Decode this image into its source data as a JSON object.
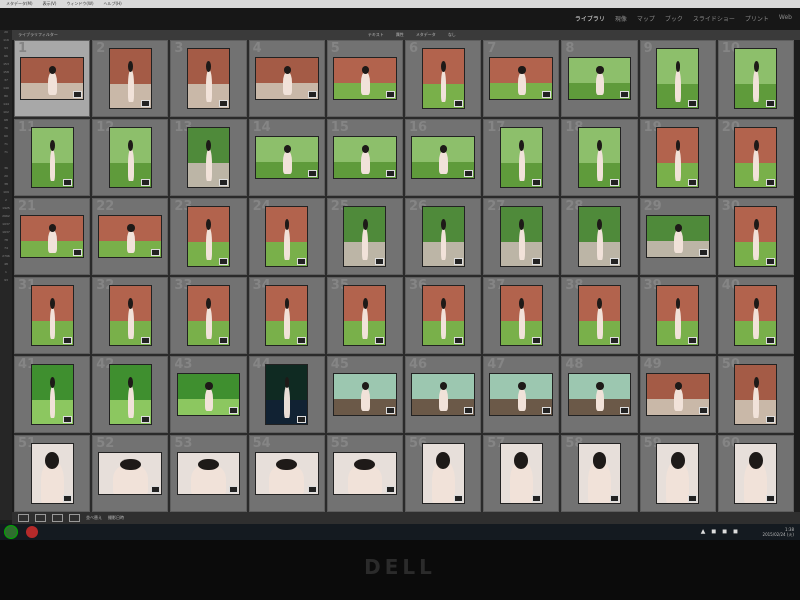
{
  "menubar": {
    "items": [
      "メタデータ(M)",
      "表示(V)",
      "ウィンドウ(W)",
      "ヘルプ(H)"
    ]
  },
  "modules": {
    "items": [
      "ライブラリ",
      "現像",
      "マップ",
      "ブック",
      "スライドショー",
      "プリント",
      "Web"
    ],
    "active_index": 0
  },
  "grid_header": {
    "left_label": "ライブラリフィルター",
    "tabs": [
      "テキスト",
      "属性",
      "メタデータ",
      "なし"
    ]
  },
  "left_numbers": [
    "20",
    "116",
    "93",
    "66",
    "153",
    "158",
    "37",
    "140",
    "80",
    "144",
    "102",
    "68",
    "76",
    "60",
    "71",
    "71",
    "",
    "36",
    "20",
    "38",
    "109",
    "2",
    "1925",
    "2662",
    "1037",
    "1637",
    "78",
    "74",
    "2796",
    "48",
    "1",
    "93"
  ],
  "thumbnails": [
    {
      "idx": "1",
      "o": "land",
      "s": "s-brick"
    },
    {
      "idx": "2",
      "o": "port",
      "s": "s-brick"
    },
    {
      "idx": "3",
      "o": "port",
      "s": "s-brick"
    },
    {
      "idx": "4",
      "o": "land",
      "s": "s-brick"
    },
    {
      "idx": "5",
      "o": "land",
      "s": "s-building"
    },
    {
      "idx": "6",
      "o": "port",
      "s": "s-building"
    },
    {
      "idx": "7",
      "o": "land",
      "s": "s-building"
    },
    {
      "idx": "8",
      "o": "land",
      "s": "s-lawn"
    },
    {
      "idx": "9",
      "o": "port",
      "s": "s-lawn"
    },
    {
      "idx": "10",
      "o": "port",
      "s": "s-lawn"
    },
    {
      "idx": "11",
      "o": "port",
      "s": "s-lawn"
    },
    {
      "idx": "12",
      "o": "port",
      "s": "s-lawn"
    },
    {
      "idx": "13",
      "o": "port",
      "s": "s-park"
    },
    {
      "idx": "14",
      "o": "land",
      "s": "s-lawn"
    },
    {
      "idx": "15",
      "o": "land",
      "s": "s-lawn"
    },
    {
      "idx": "16",
      "o": "land",
      "s": "s-lawn"
    },
    {
      "idx": "17",
      "o": "port",
      "s": "s-lawn"
    },
    {
      "idx": "18",
      "o": "port",
      "s": "s-lawn"
    },
    {
      "idx": "19",
      "o": "port",
      "s": "s-building"
    },
    {
      "idx": "20",
      "o": "port",
      "s": "s-building"
    },
    {
      "idx": "21",
      "o": "land",
      "s": "s-building"
    },
    {
      "idx": "22",
      "o": "land",
      "s": "s-building"
    },
    {
      "idx": "23",
      "o": "port",
      "s": "s-building"
    },
    {
      "idx": "24",
      "o": "port",
      "s": "s-building"
    },
    {
      "idx": "25",
      "o": "port",
      "s": "s-park"
    },
    {
      "idx": "26",
      "o": "port",
      "s": "s-park"
    },
    {
      "idx": "27",
      "o": "port",
      "s": "s-park"
    },
    {
      "idx": "28",
      "o": "port",
      "s": "s-park"
    },
    {
      "idx": "29",
      "o": "land",
      "s": "s-park"
    },
    {
      "idx": "30",
      "o": "port",
      "s": "s-building"
    },
    {
      "idx": "31",
      "o": "port",
      "s": "s-building"
    },
    {
      "idx": "32",
      "o": "port",
      "s": "s-building"
    },
    {
      "idx": "33",
      "o": "port",
      "s": "s-building"
    },
    {
      "idx": "34",
      "o": "port",
      "s": "s-building"
    },
    {
      "idx": "35",
      "o": "port",
      "s": "s-building"
    },
    {
      "idx": "36",
      "o": "port",
      "s": "s-building"
    },
    {
      "idx": "37",
      "o": "port",
      "s": "s-building"
    },
    {
      "idx": "38",
      "o": "port",
      "s": "s-building"
    },
    {
      "idx": "39",
      "o": "port",
      "s": "s-building"
    },
    {
      "idx": "40",
      "o": "port",
      "s": "s-building"
    },
    {
      "idx": "41",
      "o": "port",
      "s": "s-garden"
    },
    {
      "idx": "42",
      "o": "port",
      "s": "s-garden"
    },
    {
      "idx": "43",
      "o": "land",
      "s": "s-garden"
    },
    {
      "idx": "44",
      "o": "port",
      "s": "s-dark"
    },
    {
      "idx": "45",
      "o": "land",
      "s": "s-pond"
    },
    {
      "idx": "46",
      "o": "land",
      "s": "s-pond"
    },
    {
      "idx": "47",
      "o": "land",
      "s": "s-pond"
    },
    {
      "idx": "48",
      "o": "land",
      "s": "s-pond"
    },
    {
      "idx": "49",
      "o": "land",
      "s": "s-brick"
    },
    {
      "idx": "50",
      "o": "port",
      "s": "s-brick"
    },
    {
      "idx": "51",
      "o": "port",
      "s": "s-portrait"
    },
    {
      "idx": "52",
      "o": "land",
      "s": "s-portrait"
    },
    {
      "idx": "53",
      "o": "land",
      "s": "s-portrait"
    },
    {
      "idx": "54",
      "o": "land",
      "s": "s-portrait"
    },
    {
      "idx": "55",
      "o": "land",
      "s": "s-portrait"
    },
    {
      "idx": "56",
      "o": "port",
      "s": "s-portrait"
    },
    {
      "idx": "57",
      "o": "port",
      "s": "s-portrait"
    },
    {
      "idx": "58",
      "o": "port",
      "s": "s-portrait"
    },
    {
      "idx": "59",
      "o": "port",
      "s": "s-portrait"
    },
    {
      "idx": "60",
      "o": "port",
      "s": "s-portrait"
    }
  ],
  "selected_index": 0,
  "toolbar": {
    "sort_label": "並べ替え",
    "sort_value": "撮影日時"
  },
  "taskbar": {
    "time": "1:38",
    "date": "2015/02/24 (火)"
  },
  "monitor": {
    "brand": "DELL"
  }
}
